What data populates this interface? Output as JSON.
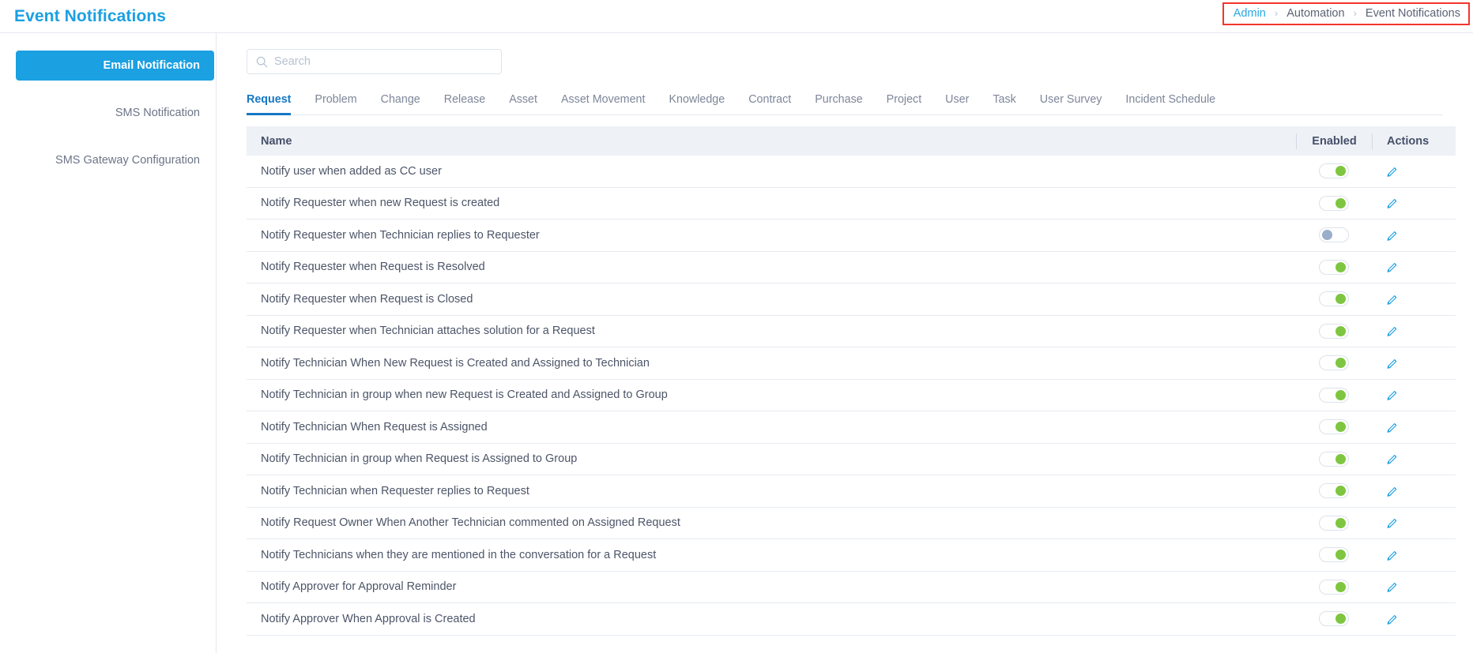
{
  "header": {
    "title": "Event Notifications",
    "breadcrumb": [
      {
        "label": "Admin",
        "link": true
      },
      {
        "label": "Automation",
        "link": false
      },
      {
        "label": "Event Notifications",
        "link": false
      }
    ],
    "breadcrumb_separator": "›",
    "highlight_color": "#f4352c",
    "title_color": "#1ba0e2"
  },
  "sidebar": {
    "items": [
      {
        "label": "Email Notification",
        "active": true
      },
      {
        "label": "SMS Notification",
        "active": false
      },
      {
        "label": "SMS Gateway Configuration",
        "active": false
      }
    ]
  },
  "search": {
    "placeholder": "Search",
    "value": "",
    "icon": "search-icon"
  },
  "tabs": [
    {
      "label": "Request",
      "active": true
    },
    {
      "label": "Problem",
      "active": false
    },
    {
      "label": "Change",
      "active": false
    },
    {
      "label": "Release",
      "active": false
    },
    {
      "label": "Asset",
      "active": false
    },
    {
      "label": "Asset Movement",
      "active": false
    },
    {
      "label": "Knowledge",
      "active": false
    },
    {
      "label": "Contract",
      "active": false
    },
    {
      "label": "Purchase",
      "active": false
    },
    {
      "label": "Project",
      "active": false
    },
    {
      "label": "User",
      "active": false
    },
    {
      "label": "Task",
      "active": false
    },
    {
      "label": "User Survey",
      "active": false
    },
    {
      "label": "Incident Schedule",
      "active": false
    }
  ],
  "table": {
    "columns": {
      "name": "Name",
      "enabled": "Enabled",
      "actions": "Actions"
    },
    "action_icon": "pencil-icon",
    "toggle_on_color": "#7ec640",
    "toggle_off_color": "#99aec8",
    "rows": [
      {
        "name": "Notify user when added as CC user",
        "enabled": true
      },
      {
        "name": "Notify Requester when new Request is created",
        "enabled": true
      },
      {
        "name": "Notify Requester when Technician replies to Requester",
        "enabled": false
      },
      {
        "name": "Notify Requester when Request is Resolved",
        "enabled": true
      },
      {
        "name": "Notify Requester when Request is Closed",
        "enabled": true
      },
      {
        "name": "Notify Requester when Technician attaches solution for a Request",
        "enabled": true
      },
      {
        "name": "Notify Technician When New Request is Created and Assigned to Technician",
        "enabled": true
      },
      {
        "name": "Notify Technician in group when new Request is Created and Assigned to Group",
        "enabled": true
      },
      {
        "name": "Notify Technician When Request is Assigned",
        "enabled": true
      },
      {
        "name": "Notify Technician in group when Request is Assigned to Group",
        "enabled": true
      },
      {
        "name": "Notify Technician when Requester replies to Request",
        "enabled": true
      },
      {
        "name": "Notify Request Owner When Another Technician commented on Assigned Request",
        "enabled": true
      },
      {
        "name": "Notify Technicians when they are mentioned in the conversation for a Request",
        "enabled": true
      },
      {
        "name": "Notify Approver for Approval Reminder",
        "enabled": true
      },
      {
        "name": "Notify Approver When Approval is Created",
        "enabled": true
      }
    ]
  }
}
